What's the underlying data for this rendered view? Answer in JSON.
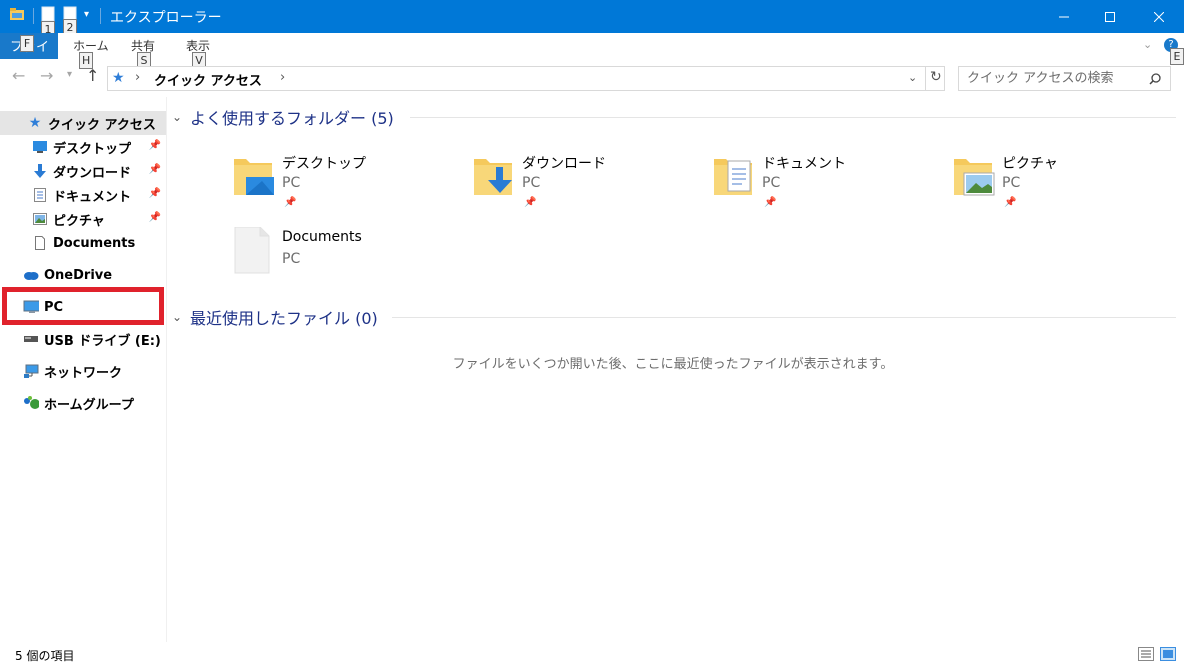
{
  "window": {
    "title": "エクスプローラー",
    "keytips": {
      "qa1": "1",
      "qa2": "2",
      "file": "F",
      "home": "H",
      "share": "S",
      "view": "V",
      "help": "E"
    }
  },
  "ribbon": {
    "file_tab": "ファイル",
    "tabs": [
      {
        "label": "ホーム"
      },
      {
        "label": "共有"
      },
      {
        "label": "表示"
      }
    ]
  },
  "address": {
    "crumbs": [
      "クイック アクセス"
    ],
    "search_placeholder": "クイック アクセスの検索"
  },
  "nav": {
    "items": [
      {
        "label": "クイック アクセス",
        "icon": "star-icon",
        "pinned": false,
        "selected": true
      },
      {
        "label": "デスクトップ",
        "icon": "desktop-icon",
        "pinned": true
      },
      {
        "label": "ダウンロード",
        "icon": "download-icon",
        "pinned": true
      },
      {
        "label": "ドキュメント",
        "icon": "documents-icon",
        "pinned": true
      },
      {
        "label": "ピクチャ",
        "icon": "pictures-icon",
        "pinned": true
      },
      {
        "label": "Documents",
        "icon": "file-icon",
        "pinned": false
      },
      {
        "label": "OneDrive",
        "icon": "cloud-icon"
      },
      {
        "label": "PC",
        "icon": "computer-icon",
        "highlighted": true
      },
      {
        "label": "USB ドライブ (E:)",
        "icon": "usb-drive-icon"
      },
      {
        "label": "ネットワーク",
        "icon": "network-icon"
      },
      {
        "label": "ホームグループ",
        "icon": "homegroup-icon"
      }
    ]
  },
  "frequent": {
    "header": "よく使用するフォルダー (5)",
    "items": [
      {
        "name": "デスクトップ",
        "location": "PC",
        "pinned": true,
        "icon": "desktop-folder-icon"
      },
      {
        "name": "ダウンロード",
        "location": "PC",
        "pinned": true,
        "icon": "download-folder-icon"
      },
      {
        "name": "ドキュメント",
        "location": "PC",
        "pinned": true,
        "icon": "documents-folder-icon"
      },
      {
        "name": "ピクチャ",
        "location": "PC",
        "pinned": true,
        "icon": "pictures-folder-icon"
      },
      {
        "name": "Documents",
        "location": "PC",
        "pinned": false,
        "icon": "blank-file-icon"
      }
    ]
  },
  "recent": {
    "header": "最近使用したファイル (0)",
    "empty_message": "ファイルをいくつか開いた後、ここに最近使ったファイルが表示されます。"
  },
  "status": {
    "count": "5 個の項目"
  },
  "colors": {
    "titlebar": "#0078d7",
    "group_header": "#1e3287",
    "highlight": "#e0222c",
    "folder": "#f5c95c"
  }
}
